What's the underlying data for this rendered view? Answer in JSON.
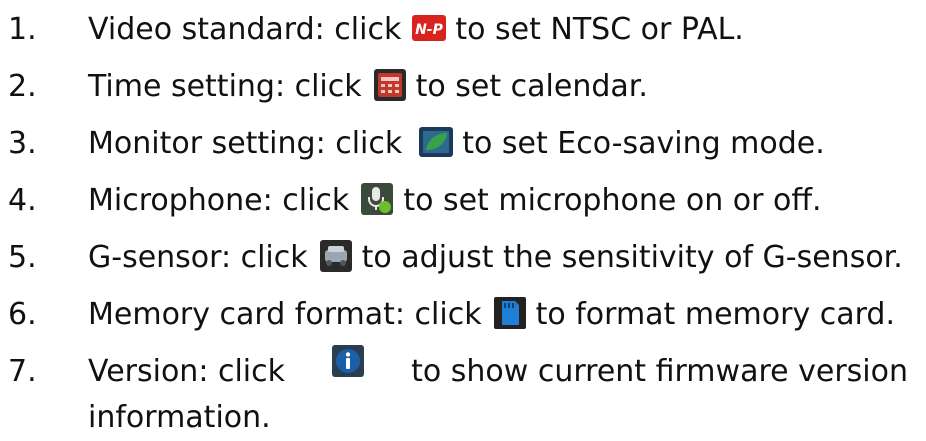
{
  "items": [
    {
      "num": "1.",
      "before": "Video standard: click",
      "icon": "ntsc-pal-icon",
      "after": "to set NTSC or PAL."
    },
    {
      "num": "2.",
      "before": "Time setting: click",
      "icon": "calendar-icon",
      "after": "to set calendar."
    },
    {
      "num": "3.",
      "before": "Monitor setting: click",
      "icon": "monitor-eco-icon",
      "after": "to set Eco-saving mode."
    },
    {
      "num": "4.",
      "before": "Microphone: click",
      "icon": "microphone-icon",
      "after": "to set microphone on or off."
    },
    {
      "num": "5.",
      "before": "G-sensor: click",
      "icon": "g-sensor-icon",
      "after": "to adjust the sensitivity of G-sensor."
    },
    {
      "num": "6.",
      "before": "Memory card format: click",
      "icon": "memory-card-icon",
      "after": "to format memory card."
    },
    {
      "num": "7.",
      "before": "Version: click",
      "icon": "info-icon",
      "after": "to show current firmware version",
      "after_line2": "information."
    }
  ],
  "icon_labels": {
    "ntsc_pal": "N-P"
  },
  "colors": {
    "text": "#111111",
    "ntsc_red": "#d8231e",
    "calendar_red": "#c0392b",
    "eco_green": "#3aa14b",
    "card_blue": "#1f7fd6",
    "info_blue": "#1b5fa8"
  }
}
